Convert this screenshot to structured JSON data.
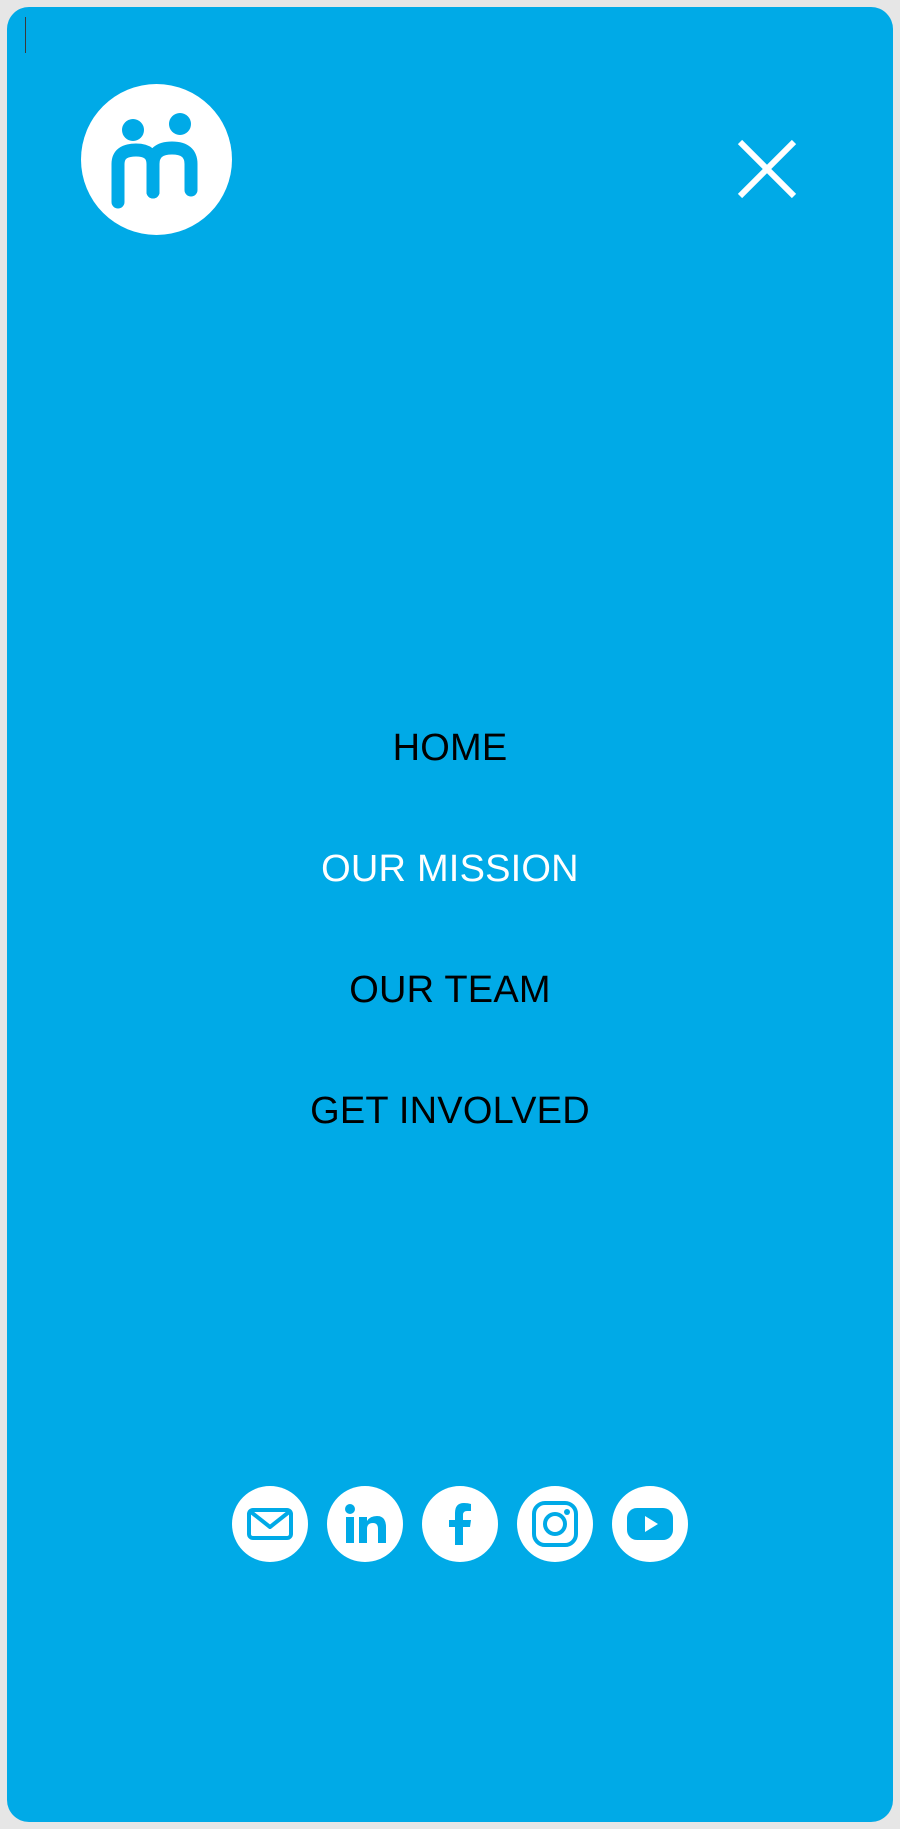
{
  "theme": {
    "background": "#00aae7",
    "nav_text": "#000000",
    "nav_active_text": "#ffffff",
    "icon_fill": "#ffffff"
  },
  "header": {
    "logo_icon": "people-circle-icon",
    "close_icon": "close-icon"
  },
  "nav": {
    "items": [
      {
        "label": "HOME",
        "active": false
      },
      {
        "label": "OUR MISSION",
        "active": true
      },
      {
        "label": "OUR TEAM",
        "active": false
      },
      {
        "label": "GET INVOLVED",
        "active": false
      }
    ]
  },
  "social": {
    "icons": [
      "email-icon",
      "linkedin-icon",
      "facebook-icon",
      "instagram-icon",
      "youtube-icon"
    ]
  }
}
